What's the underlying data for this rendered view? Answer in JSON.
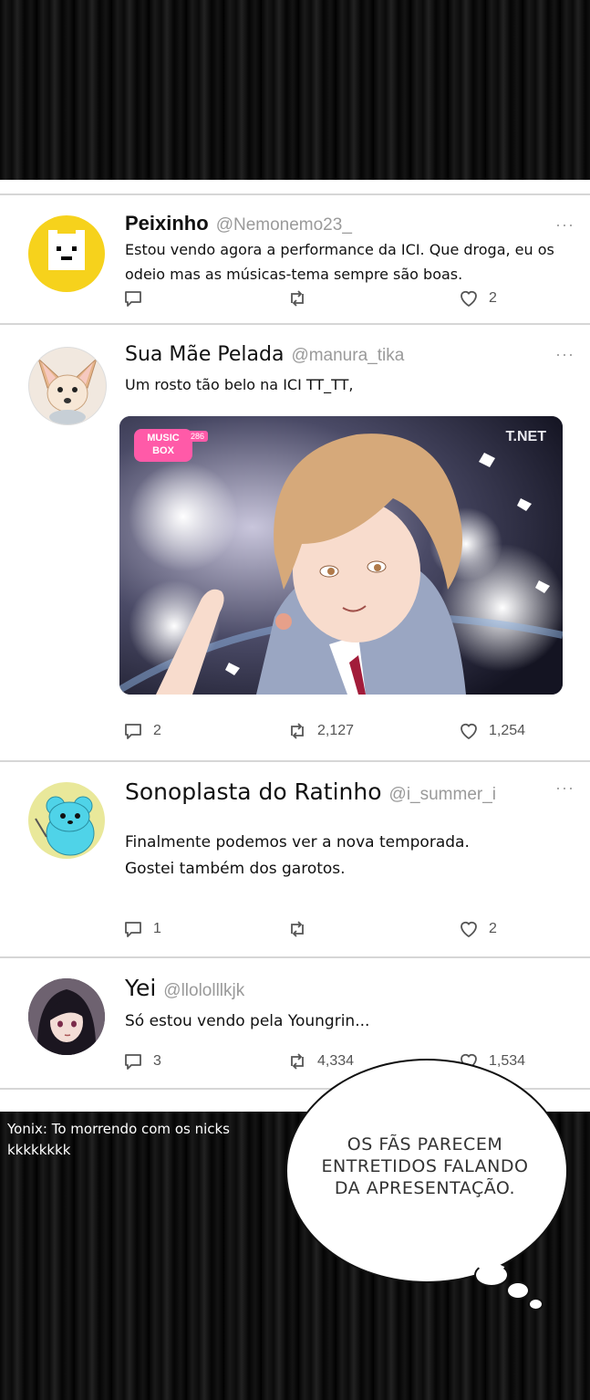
{
  "tweets": [
    {
      "name": "Peixinho",
      "handle": "@Nemonemo23_",
      "text": "Estou vendo agora a performance da ICI. Que droga, eu os odeio mas as músicas-tema sempre são boas.",
      "replies": "",
      "retweets": "",
      "likes": "2",
      "avatar": "yellow-block-face"
    },
    {
      "name": "Sua Mãe Pelada",
      "handle": "@manura_tika",
      "text": "Um rosto tão belo na ICI TT_TT,",
      "replies": "2",
      "retweets": "2,127",
      "likes": "1,254",
      "avatar": "fennec-fox",
      "media": {
        "watermark": "T.NET",
        "logo_line1": "MUSIC",
        "logo_line2": "BOX",
        "badge": "286"
      }
    },
    {
      "name": "Sonoplasta do Ratinho",
      "handle": "@i_summer_i",
      "text_lines": [
        "Finalmente podemos ver a nova temporada.",
        "Gostei também dos garotos."
      ],
      "replies": "1",
      "retweets": "",
      "likes": "2",
      "avatar": "blue-creature"
    },
    {
      "name": "Yei",
      "handle": "@llololllkjk",
      "text": "Só estou vendo pela Youngrin...",
      "replies": "3",
      "retweets": "4,334",
      "likes": "1,534",
      "avatar": "dark-hair-girl"
    }
  ],
  "more_glyph": "···",
  "bubble": {
    "lines": [
      "OS FÃS PARECEM",
      "ENTRETIDOS FALANDO",
      "DA APRESENTAÇÃO."
    ]
  },
  "credit": {
    "lines": [
      "Yonix: To morrendo com os nicks",
      "kkkkkkkk"
    ]
  },
  "colors": {
    "icon_gray": "#555555",
    "handle_gray": "#9a9a9a",
    "avatar1": "#f6d21c",
    "avatar3": "#e9e89a",
    "creature": "#4fd3e8"
  }
}
